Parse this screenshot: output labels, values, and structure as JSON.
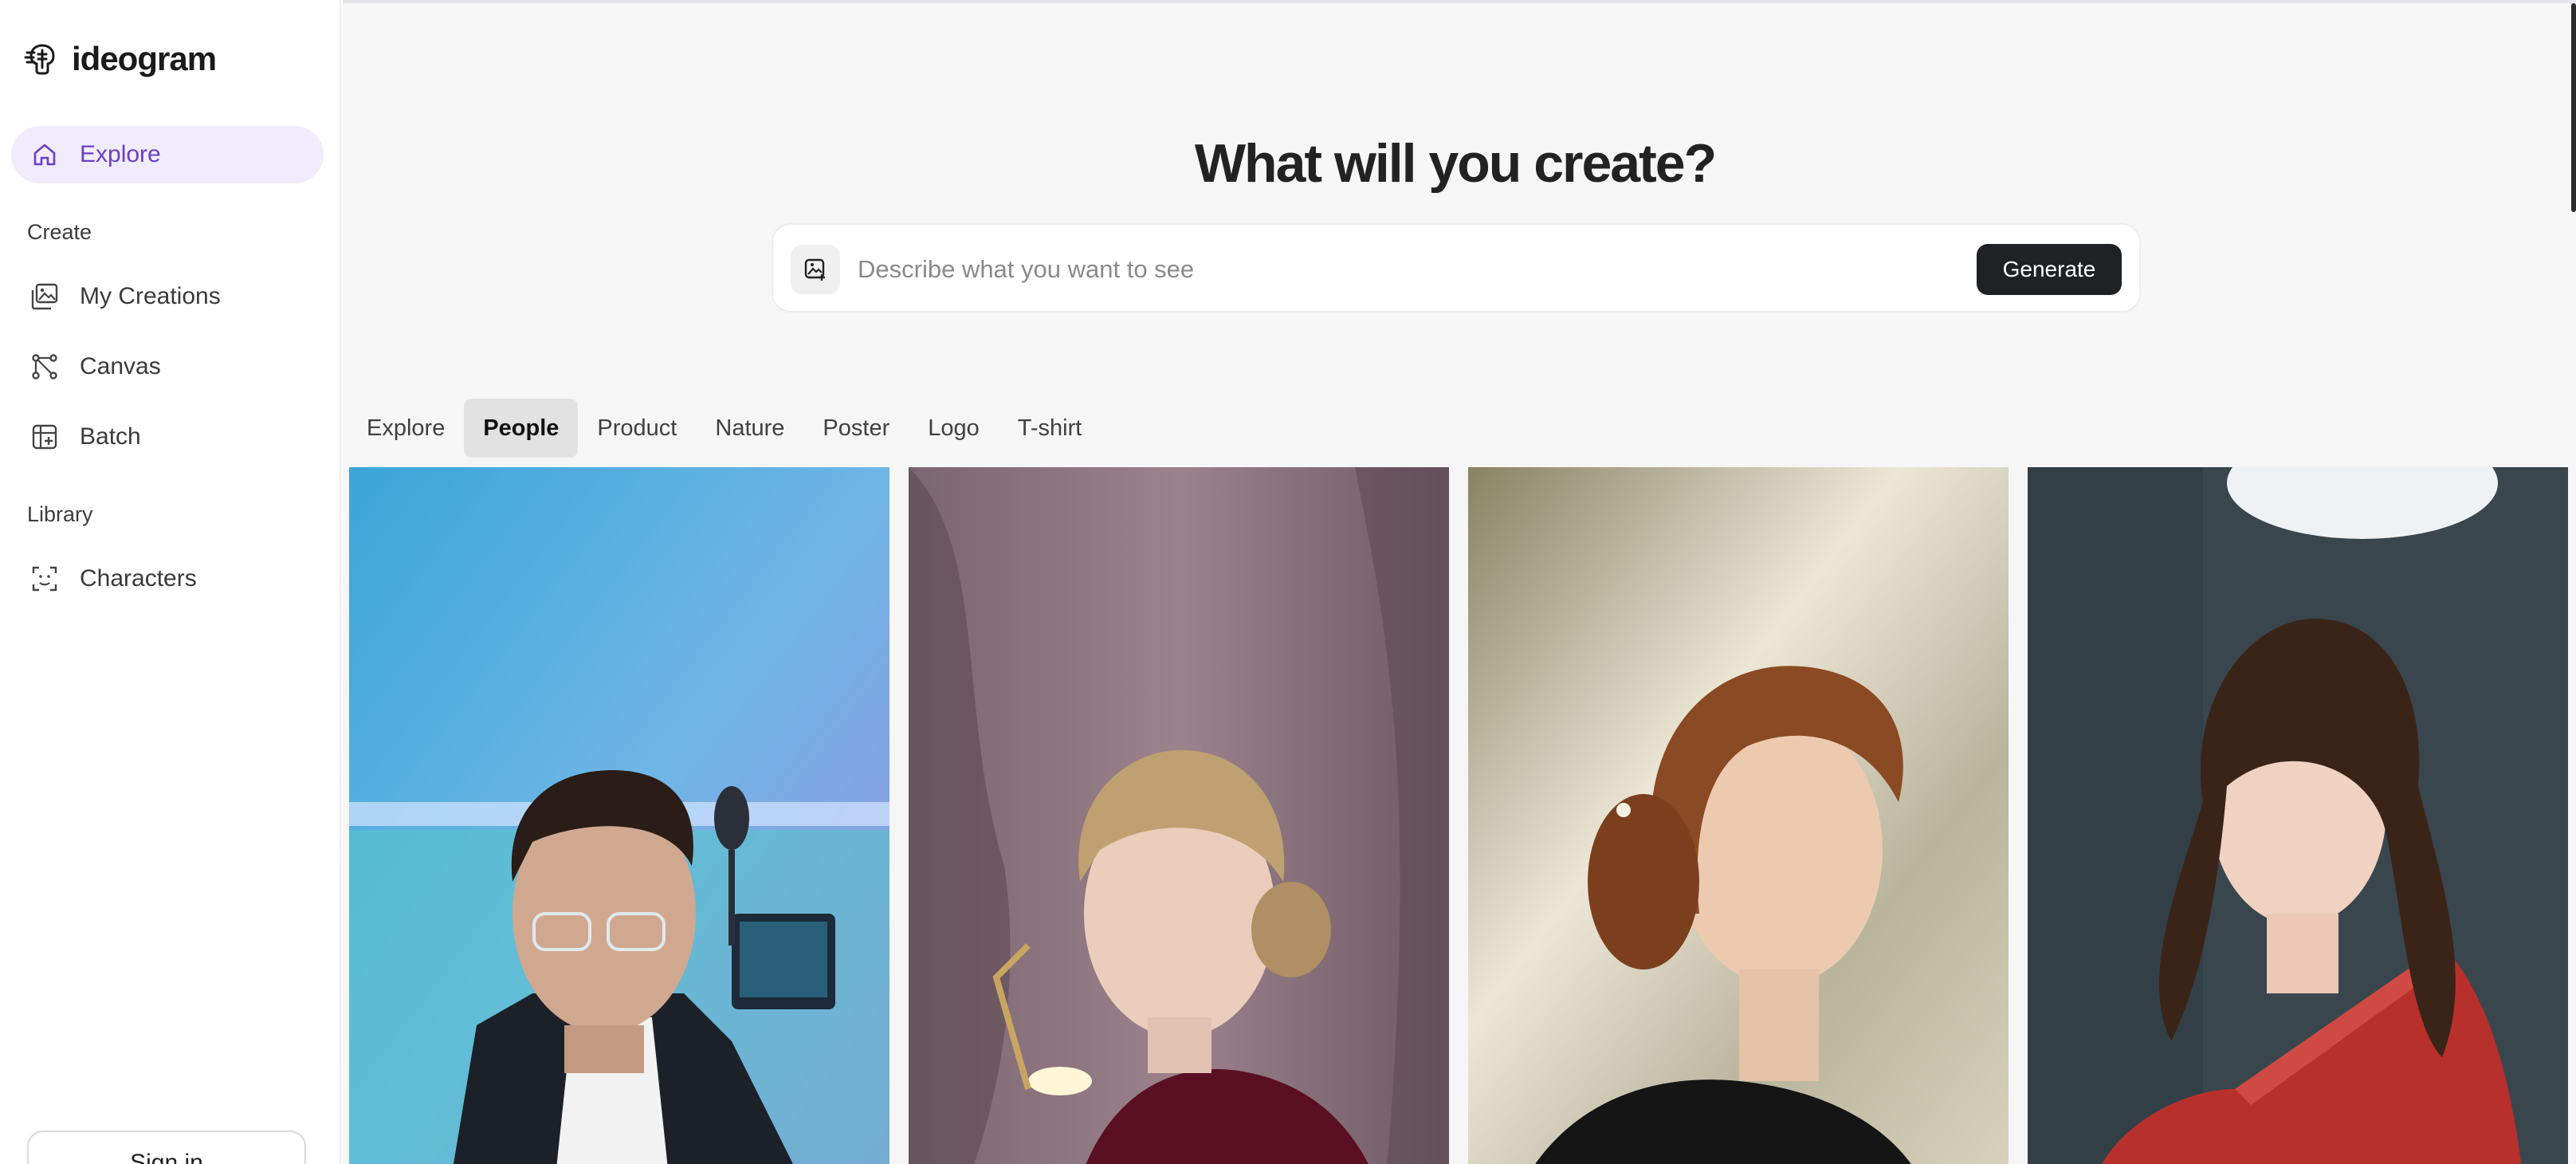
{
  "brand": {
    "name": "ideogram",
    "icon": "ideogram-logo-icon"
  },
  "sidebar": {
    "items": [
      {
        "label": "Explore",
        "icon": "home-icon",
        "active": true
      }
    ],
    "create_label": "Create",
    "create_items": [
      {
        "label": "My Creations",
        "icon": "images-icon"
      },
      {
        "label": "Canvas",
        "icon": "canvas-icon"
      },
      {
        "label": "Batch",
        "icon": "batch-icon"
      }
    ],
    "library_label": "Library",
    "library_items": [
      {
        "label": "Characters",
        "icon": "face-scan-icon"
      }
    ],
    "signin_label": "Sign in"
  },
  "hero": {
    "title": "What will you create?",
    "placeholder": "Describe what you want to see",
    "generate_label": "Generate",
    "image_button_icon": "image-upload-icon"
  },
  "tabs": [
    {
      "label": "Explore",
      "active": false
    },
    {
      "label": "People",
      "active": true
    },
    {
      "label": "Product",
      "active": false
    },
    {
      "label": "Nature",
      "active": false
    },
    {
      "label": "Poster",
      "active": false
    },
    {
      "label": "Logo",
      "active": false
    },
    {
      "label": "T-shirt",
      "active": false
    }
  ],
  "colors": {
    "accent": "#6b3fc4",
    "accent_bg": "#f1ecfb",
    "generate_bg": "#1f2125",
    "main_bg": "#f6f6f6"
  }
}
